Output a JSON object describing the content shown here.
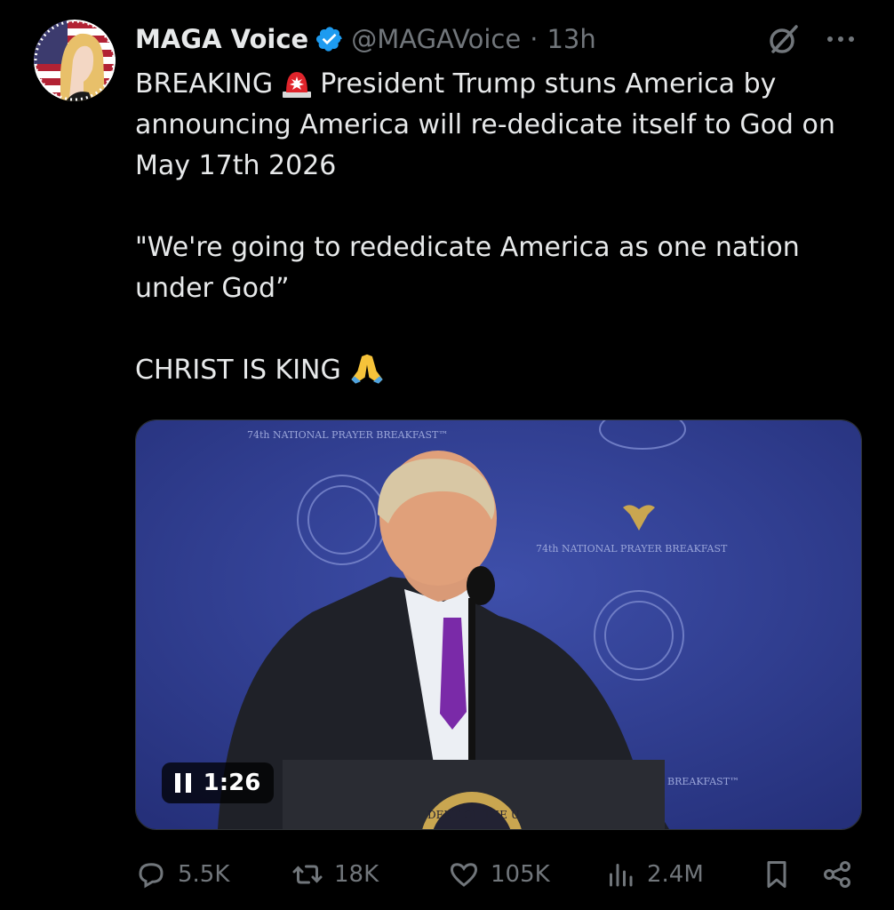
{
  "author": {
    "name": "MAGA Voice",
    "handle": "@MAGAVoice",
    "separator": "·",
    "time": "13h"
  },
  "icons": {
    "verified": "verified-badge-icon",
    "grok": "grok-icon",
    "more": "more-options-icon",
    "siren": "police-light-emoji",
    "pray": "folded-hands-emoji"
  },
  "colors": {
    "background": "#000000",
    "text": "#e7e9ea",
    "muted": "#71767b",
    "verified": "#1d9bf0"
  },
  "tweet": {
    "line1_prefix": "BREAKING ",
    "line1_rest": " President Trump stuns America by announcing America will re-dedicate itself to God on May 17th 2026",
    "quote": "\"We're going to rededicate America as one nation under God”",
    "closing": "CHRIST IS KING "
  },
  "media": {
    "backdrop_text": "74th NATIONAL PRAYER BREAKFAST",
    "backdrop_text_top": "74th NATIONAL PRAYER BREAKFAST™",
    "backdrop_text_right": "BREAKFAST™",
    "podium_seal_text": "DENT OF THE U",
    "duration": "1:26"
  },
  "actions": {
    "replies": "5.5K",
    "reposts": "18K",
    "likes": "105K",
    "views": "2.4M"
  }
}
